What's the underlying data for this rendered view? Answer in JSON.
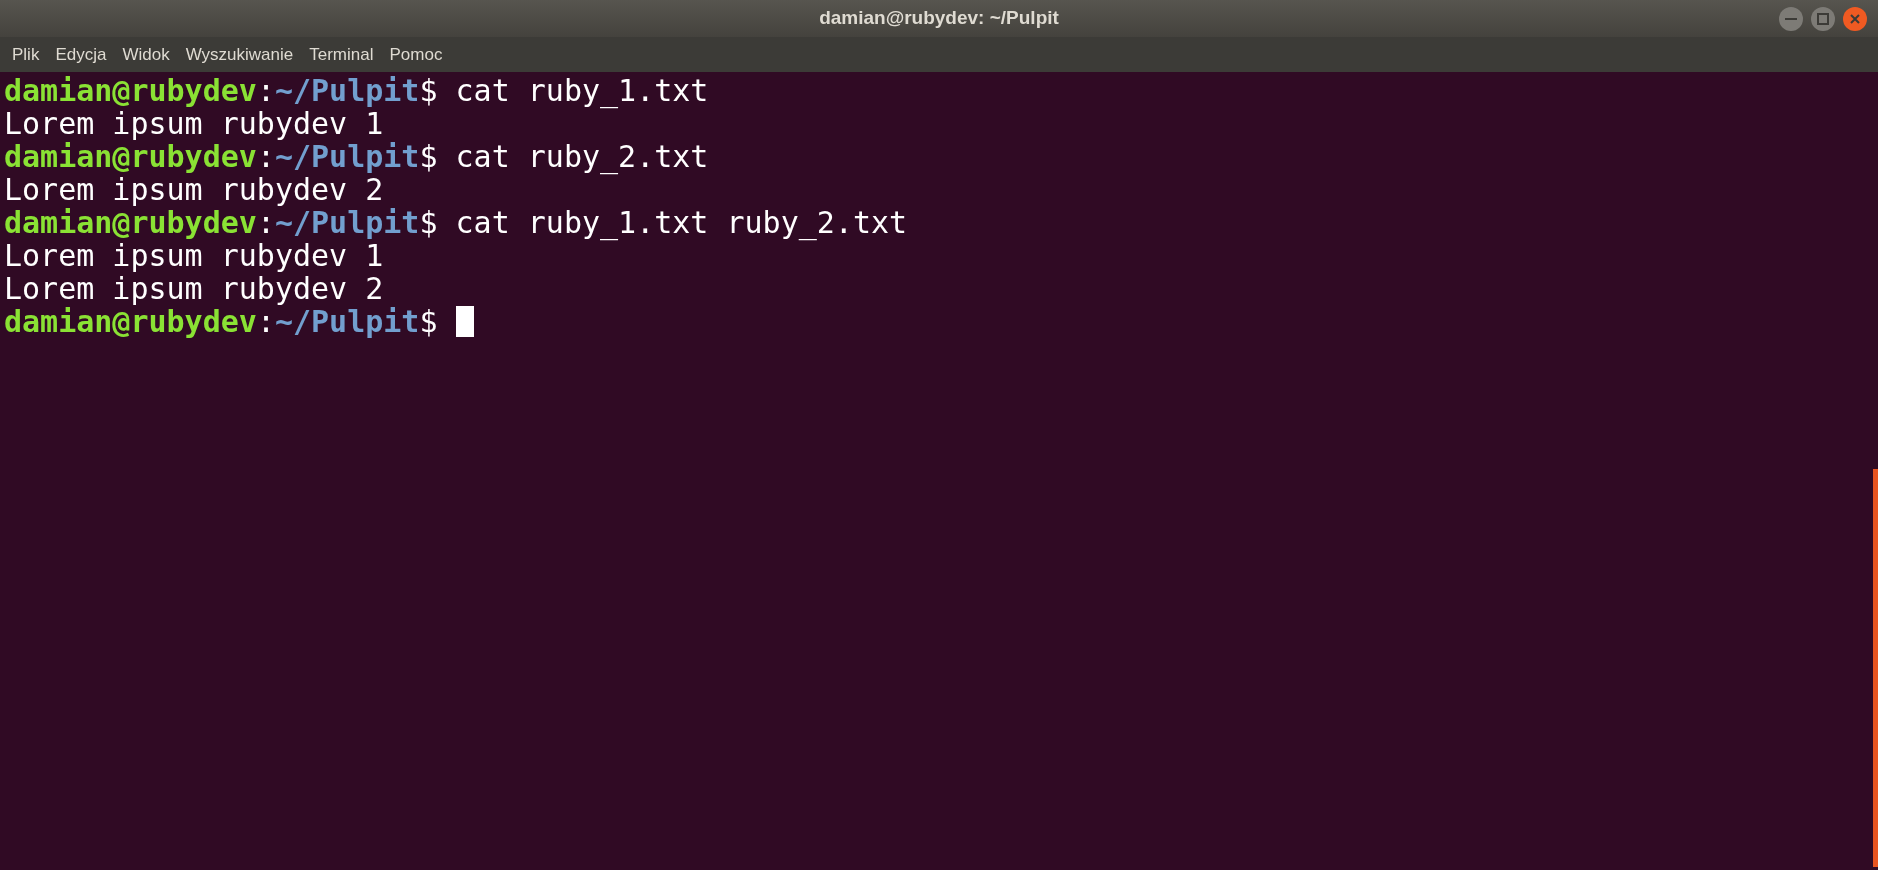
{
  "window": {
    "title": "damian@rubydev: ~/Pulpit"
  },
  "menu": [
    "Plik",
    "Edycja",
    "Widok",
    "Wyszukiwanie",
    "Terminal",
    "Pomoc"
  ],
  "terminal": {
    "lines": [
      {
        "kind": "prompt",
        "user_host": "damian@rubydev",
        "separator": ":",
        "path": "~/Pulpit",
        "symbol": "$",
        "command": "cat ruby_1.txt"
      },
      {
        "kind": "output",
        "text": "Lorem ipsum rubydev 1"
      },
      {
        "kind": "prompt",
        "user_host": "damian@rubydev",
        "separator": ":",
        "path": "~/Pulpit",
        "symbol": "$",
        "command": "cat ruby_2.txt"
      },
      {
        "kind": "output",
        "text": "Lorem ipsum rubydev 2"
      },
      {
        "kind": "prompt",
        "user_host": "damian@rubydev",
        "separator": ":",
        "path": "~/Pulpit",
        "symbol": "$",
        "command": "cat ruby_1.txt ruby_2.txt"
      },
      {
        "kind": "output",
        "text": "Lorem ipsum rubydev 1"
      },
      {
        "kind": "output",
        "text": "Lorem ipsum rubydev 2"
      },
      {
        "kind": "prompt",
        "user_host": "damian@rubydev",
        "separator": ":",
        "path": "~/Pulpit",
        "symbol": "$",
        "cursor": true
      }
    ]
  }
}
